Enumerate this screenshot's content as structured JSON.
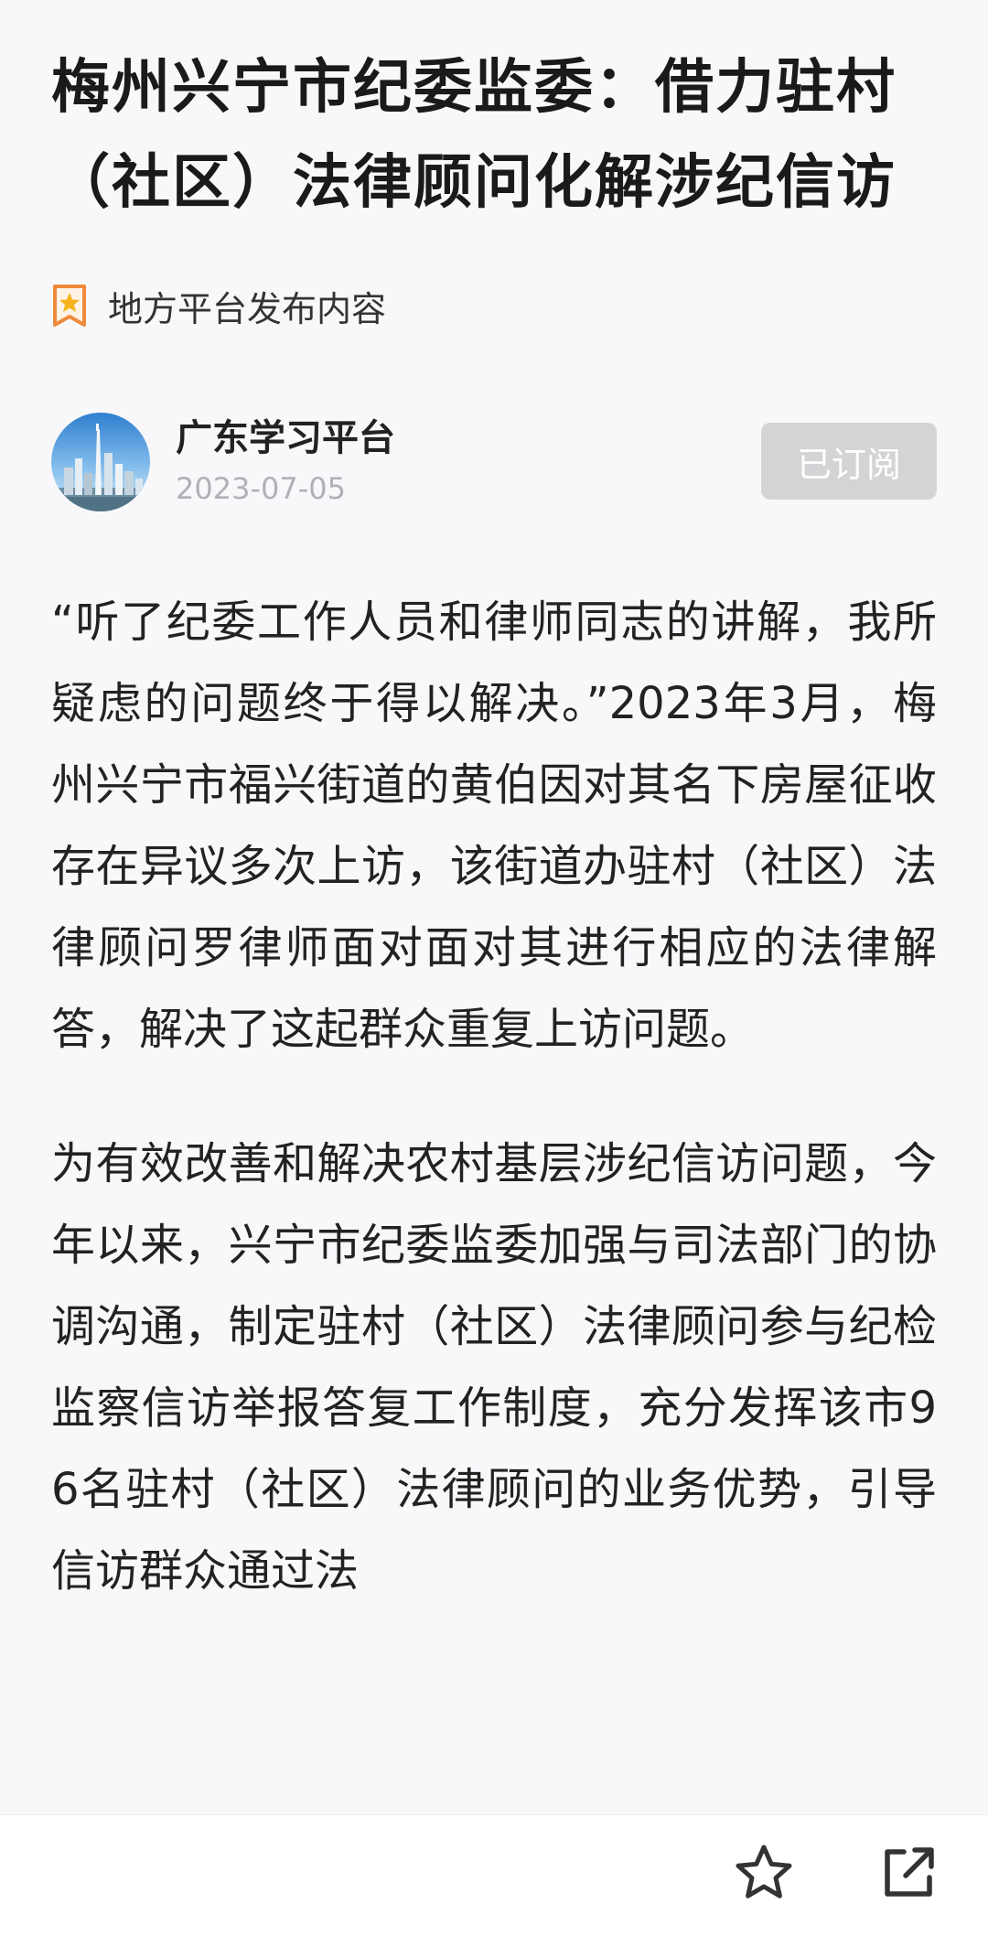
{
  "article": {
    "title": "梅州兴宁市纪委监委：借力驻村（社区）法律顾问化解涉纪信访",
    "source_tag": "地方平台发布内容",
    "author": {
      "name": "广东学习平台",
      "date": "2023-07-05",
      "subscribe_label": "已订阅"
    },
    "paragraphs": [
      "“听了纪委工作人员和律师同志的讲解，我所疑虑的问题终于得以解决。”2023年3月，梅州兴宁市福兴街道的黄伯因对其名下房屋征收存在异议多次上访，该街道办驻村（社区）法律顾问罗律师面对面对其进行相应的法律解答，解决了这起群众重复上访问题。",
      "为有效改善和解决农村基层涉纪信访问题，今年以来，兴宁市纪委监委加强与司法部门的协调沟通，制定驻村（社区）法律顾问参与纪检监察信访举报答复工作制度，充分发挥该市96名驻村（社区）法律顾问的业务优势，引导信访群众通过法"
    ]
  },
  "bottom_bar": {
    "actions": [
      {
        "name": "favorite",
        "icon": "star-outline-icon"
      },
      {
        "name": "share",
        "icon": "share-external-icon"
      }
    ]
  },
  "colors": {
    "page_background": "#f8f8fb",
    "title_text": "#1a1a1a",
    "body_text": "#222222",
    "date_text": "#b0b0b6",
    "subscribe_button_bg": "#d4d4d7",
    "tag_icon_orange": "#f08a3c",
    "tag_icon_star": "#f5b31c"
  }
}
